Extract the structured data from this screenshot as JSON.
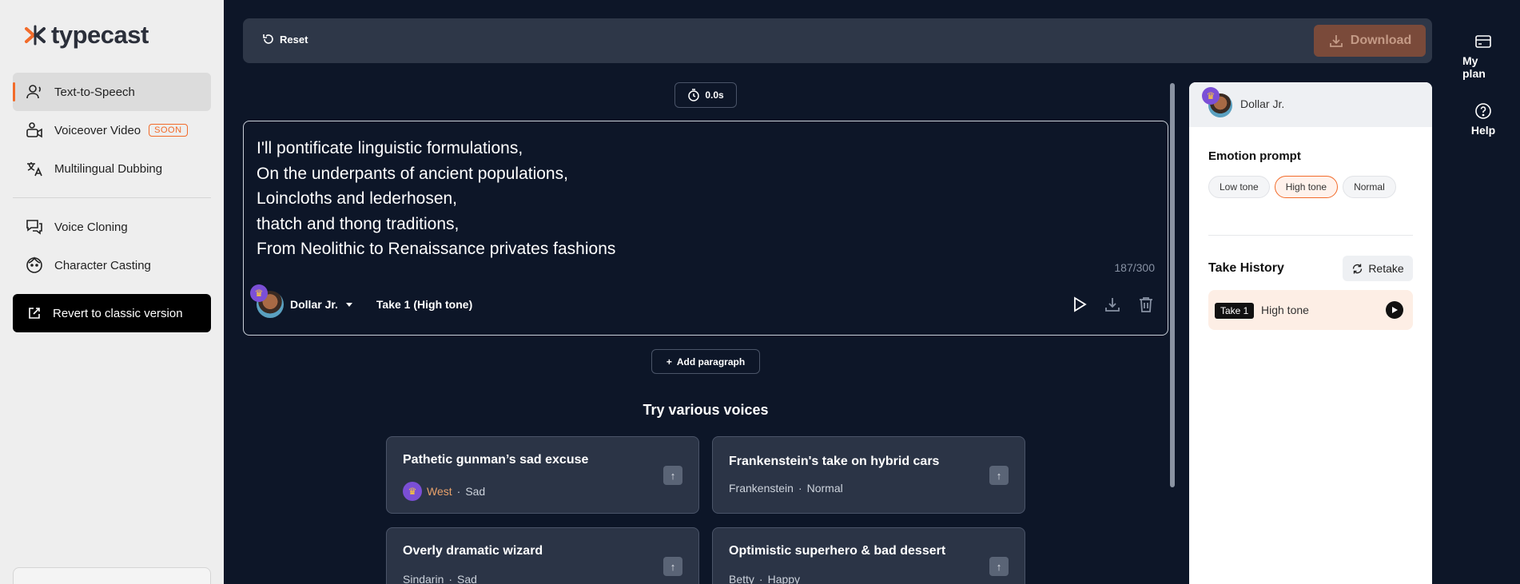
{
  "sidebar": {
    "logo_text": "typecast",
    "items": [
      {
        "label": "Text-to-Speech",
        "icon": "voice-person-icon"
      },
      {
        "label": "Voiceover Video",
        "icon": "video-person-icon",
        "badge": "SOON"
      },
      {
        "label": "Multilingual Dubbing",
        "icon": "translate-icon"
      },
      {
        "label": "Voice Cloning",
        "icon": "chat-bubbles-icon"
      },
      {
        "label": "Character Casting",
        "icon": "face-icon"
      }
    ],
    "revert_label": "Revert to classic version"
  },
  "toolbar": {
    "reset_label": "Reset",
    "download_label": "Download"
  },
  "editor": {
    "duration": "0.0s",
    "lines": [
      "I'll pontificate linguistic formulations,",
      "On the underpants of ancient populations,",
      "Loincloths and lederhosen,",
      "thatch and thong traditions,",
      "From Neolithic to Renaissance privates fashions"
    ],
    "char_count": "187/300",
    "voice_name": "Dollar Jr.",
    "take_label": "Take 1 (High tone)"
  },
  "add_paragraph_label": "Add paragraph",
  "try_voices": {
    "title": "Try various voices",
    "cards": [
      {
        "title": "Pathetic gunman’s sad excuse",
        "voice": "West",
        "sep": "·",
        "emotion": "Sad"
      },
      {
        "title": "Frankenstein's take on hybrid cars",
        "voice": "Frankenstein",
        "sep": "·",
        "emotion": "Normal"
      },
      {
        "title": "Overly dramatic wizard",
        "voice": "Sindarin",
        "sep": "·",
        "emotion": "Sad"
      },
      {
        "title": "Optimistic superhero & bad dessert",
        "voice": "Betty",
        "sep": "·",
        "emotion": "Happy"
      }
    ]
  },
  "right_panel": {
    "voice_name": "Dollar Jr.",
    "emotion_title": "Emotion prompt",
    "chips": [
      "Low tone",
      "High tone",
      "Normal"
    ],
    "selected_chip": "High tone",
    "take_history_title": "Take History",
    "retake_label": "Retake",
    "takes": [
      {
        "badge": "Take 1",
        "label": "High tone"
      }
    ]
  },
  "side_links": {
    "plan_label": "My plan",
    "help_label": "Help"
  },
  "colors": {
    "accent": "#f26b2a",
    "background": "#0d1628",
    "premium": "#7b4fd6"
  }
}
